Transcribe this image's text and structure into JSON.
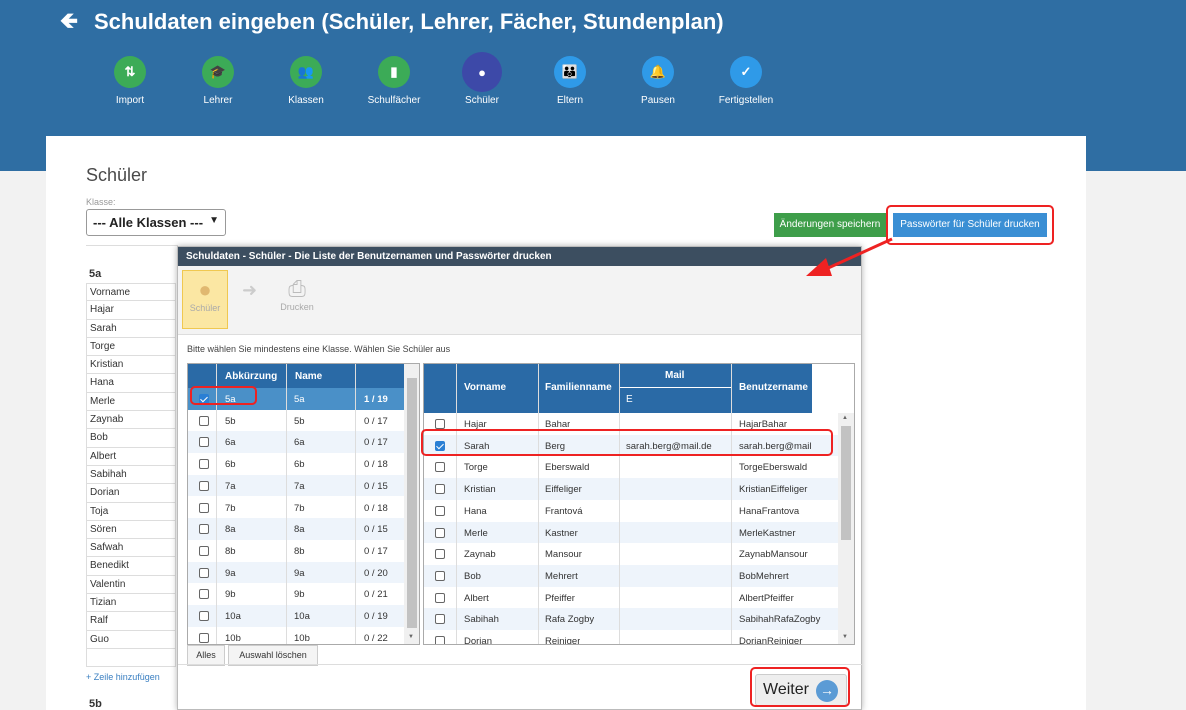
{
  "header": {
    "title": "Schuldaten eingeben (Schüler, Lehrer, Fächer, Stundenplan)",
    "steps": [
      {
        "label": "Import",
        "icon": "import-icon",
        "color": "#3cab57"
      },
      {
        "label": "Lehrer",
        "icon": "graduation-cap-icon",
        "color": "#3cab57"
      },
      {
        "label": "Klassen",
        "icon": "group-icon",
        "color": "#3cab57"
      },
      {
        "label": "Schulfächer",
        "icon": "book-icon",
        "color": "#3cab57"
      },
      {
        "label": "Schüler",
        "icon": "user-icon",
        "color": "#3d49a8"
      },
      {
        "label": "Eltern",
        "icon": "parents-icon",
        "color": "#2f9ae8"
      },
      {
        "label": "Pausen",
        "icon": "bell-icon",
        "color": "#2f9ae8"
      },
      {
        "label": "Fertigstellen",
        "icon": "check-icon",
        "color": "#2f9ae8"
      }
    ]
  },
  "page": {
    "title": "Schüler",
    "klasse_label": "Klasse:",
    "klasse_value": "--- Alle Klassen ---",
    "save_button": "Änderungen speichern",
    "pw_button": "Passwörter für Schüler drucken",
    "class_5a": "5a",
    "column_vorname": "Vorname",
    "students": [
      "Hajar",
      "Sarah",
      "Torge",
      "Kristian",
      "Hana",
      "Merle",
      "Zaynab",
      "Bob",
      "Albert",
      "Sabihah",
      "Dorian",
      "Toja",
      "Sören",
      "Safwah",
      "Benedikt",
      "Valentin",
      "Tizian",
      "Ralf",
      "Guo",
      ""
    ],
    "add_row": "+ Zeile hinzufügen",
    "class_5b": "5b"
  },
  "modal": {
    "title": "Schuldaten - Schüler - Die Liste der Benutzernamen und Passwörter drucken",
    "tool_schueler": "Schüler",
    "tool_drucken": "Drucken",
    "info": "Bitte wählen Sie mindestens eine Klasse. Wählen Sie Schüler aus",
    "class_headers": {
      "abk": "Abkürzung",
      "name": "Name"
    },
    "classes": [
      {
        "abk": "5a",
        "name": "5a",
        "count": "1 / 19",
        "checked": true
      },
      {
        "abk": "5b",
        "name": "5b",
        "count": "0 / 17",
        "checked": false
      },
      {
        "abk": "6a",
        "name": "6a",
        "count": "0 / 17",
        "checked": false
      },
      {
        "abk": "6b",
        "name": "6b",
        "count": "0 / 18",
        "checked": false
      },
      {
        "abk": "7a",
        "name": "7a",
        "count": "0 / 15",
        "checked": false
      },
      {
        "abk": "7b",
        "name": "7b",
        "count": "0 / 18",
        "checked": false
      },
      {
        "abk": "8a",
        "name": "8a",
        "count": "0 / 15",
        "checked": false
      },
      {
        "abk": "8b",
        "name": "8b",
        "count": "0 / 17",
        "checked": false
      },
      {
        "abk": "9a",
        "name": "9a",
        "count": "0 / 20",
        "checked": false
      },
      {
        "abk": "9b",
        "name": "9b",
        "count": "0 / 21",
        "checked": false
      },
      {
        "abk": "10a",
        "name": "10a",
        "count": "0 / 19",
        "checked": false
      },
      {
        "abk": "10b",
        "name": "10b",
        "count": "0 / 22",
        "checked": false
      }
    ],
    "student_headers": {
      "vorname": "Vorname",
      "familienname": "Familienname",
      "mail": "Mail",
      "mail_sub": "E",
      "benutzername": "Benutzername"
    },
    "students": [
      {
        "vorname": "Hajar",
        "familienname": "Bahar",
        "mail": "",
        "benutzername": "HajarBahar",
        "checked": false
      },
      {
        "vorname": "Sarah",
        "familienname": "Berg",
        "mail": "sarah.berg@mail.de",
        "benutzername": "sarah.berg@mail",
        "checked": true
      },
      {
        "vorname": "Torge",
        "familienname": "Eberswald",
        "mail": "",
        "benutzername": "TorgeEberswald",
        "checked": false
      },
      {
        "vorname": "Kristian",
        "familienname": "Eiffeliger",
        "mail": "",
        "benutzername": "KristianEiffeliger",
        "checked": false
      },
      {
        "vorname": "Hana",
        "familienname": "Frantová",
        "mail": "",
        "benutzername": "HanaFrantova",
        "checked": false
      },
      {
        "vorname": "Merle",
        "familienname": "Kastner",
        "mail": "",
        "benutzername": "MerleKastner",
        "checked": false
      },
      {
        "vorname": "Zaynab",
        "familienname": "Mansour",
        "mail": "",
        "benutzername": "ZaynabMansour",
        "checked": false
      },
      {
        "vorname": "Bob",
        "familienname": "Mehrert",
        "mail": "",
        "benutzername": "BobMehrert",
        "checked": false
      },
      {
        "vorname": "Albert",
        "familienname": "Pfeiffer",
        "mail": "",
        "benutzername": "AlbertPfeiffer",
        "checked": false
      },
      {
        "vorname": "Sabihah",
        "familienname": "Rafa Zogby",
        "mail": "",
        "benutzername": "SabihahRafaZogby",
        "checked": false
      },
      {
        "vorname": "Dorian",
        "familienname": "Reiniger",
        "mail": "",
        "benutzername": "DorianReiniger",
        "checked": false
      }
    ],
    "btn_alles": "Alles",
    "btn_clear": "Auswahl löschen",
    "btn_weiter": "Weiter"
  },
  "colors": {
    "header": "#2f6ea3",
    "accent": "#3a8fd4",
    "save": "#3e9e4a",
    "highlight": "#e22222",
    "selected_row": "#4a90c8"
  }
}
